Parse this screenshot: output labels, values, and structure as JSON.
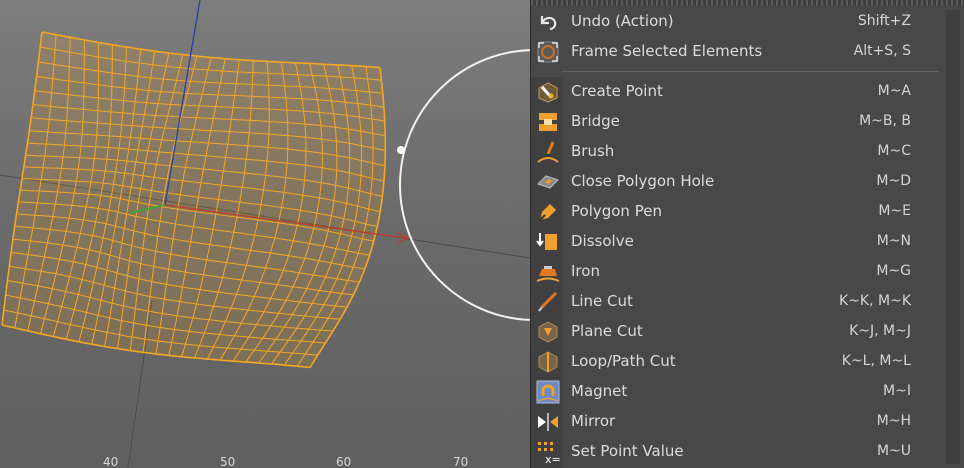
{
  "viewport": {
    "ruler_labels": [
      "40",
      "50",
      "60",
      "70"
    ]
  },
  "menu": {
    "items": [
      {
        "label": "Undo (Action)",
        "shortcut": "Shift+Z",
        "icon": "undo-icon"
      },
      {
        "label": "Frame Selected Elements",
        "shortcut": "Alt+S, S",
        "icon": "frame-selected-icon"
      },
      {
        "label": "Create Point",
        "shortcut": "M~A",
        "icon": "create-point-icon"
      },
      {
        "label": "Bridge",
        "shortcut": "M~B, B",
        "icon": "bridge-icon"
      },
      {
        "label": "Brush",
        "shortcut": "M~C",
        "icon": "brush-icon"
      },
      {
        "label": "Close Polygon Hole",
        "shortcut": "M~D",
        "icon": "close-polygon-hole-icon"
      },
      {
        "label": "Polygon Pen",
        "shortcut": "M~E",
        "icon": "polygon-pen-icon"
      },
      {
        "label": "Dissolve",
        "shortcut": "M~N",
        "icon": "dissolve-icon"
      },
      {
        "label": "Iron",
        "shortcut": "M~G",
        "icon": "iron-icon"
      },
      {
        "label": "Line Cut",
        "shortcut": "K~K, M~K",
        "icon": "line-cut-icon"
      },
      {
        "label": "Plane Cut",
        "shortcut": "K~J, M~J",
        "icon": "plane-cut-icon"
      },
      {
        "label": "Loop/Path Cut",
        "shortcut": "K~L, M~L",
        "icon": "loop-path-cut-icon"
      },
      {
        "label": "Magnet",
        "shortcut": "M~I",
        "icon": "magnet-icon"
      },
      {
        "label": "Mirror",
        "shortcut": "M~H",
        "icon": "mirror-icon"
      },
      {
        "label": "Set Point Value",
        "shortcut": "M~U",
        "icon": "set-point-value-icon"
      }
    ]
  },
  "colors": {
    "mesh": "#f5a623",
    "menu_bg": "#484848",
    "text": "#dcdcdc"
  }
}
